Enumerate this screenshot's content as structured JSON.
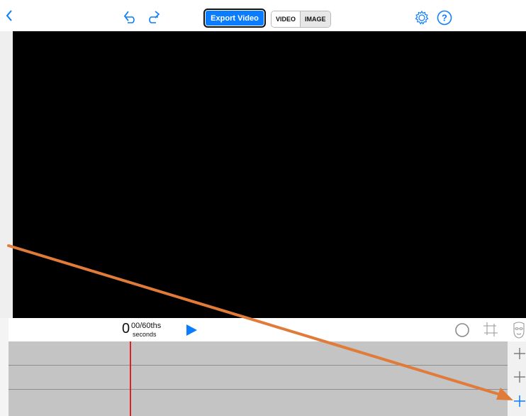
{
  "toolbar": {
    "export_label": "Export Video",
    "mode_video": "VIDEO",
    "mode_image": "IMAGE"
  },
  "icons": {
    "back": "chevron-left-icon",
    "undo": "undo-icon",
    "redo": "redo-icon",
    "settings": "gear-icon",
    "help": "question-icon",
    "play": "play-icon",
    "record": "circle-icon",
    "crop": "crop-icon",
    "mask": "mask-icon",
    "add": "plus-icon"
  },
  "playback": {
    "time_value": "0",
    "time_fraction": "00/60ths",
    "time_unit": "seconds"
  },
  "timeline": {
    "track_count": 3
  },
  "colors": {
    "accent": "#0a7cff",
    "playhead": "#e02020",
    "annotation_arrow": "#e07b39",
    "preview_bg": "#000000",
    "timeline_bg": "#c4c4c4"
  }
}
